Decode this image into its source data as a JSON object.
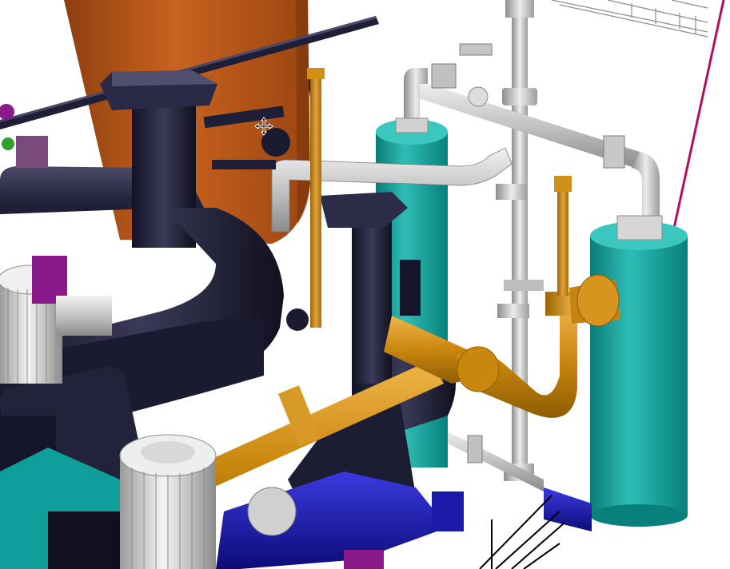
{
  "viewport": {
    "background": "#ffffff",
    "cursor": "move-cursor-icon"
  },
  "palette": {
    "navy_pipe": "#24243e",
    "navy_dark": "#121226",
    "navy_light": "#4a4a68",
    "orange_tank": "#b5561c",
    "orange_light": "#d7702c",
    "gold_pipe": "#c9870e",
    "gold_light": "#e4a63a",
    "teal_vessel": "#0f9e9a",
    "teal_light": "#3cc6c0",
    "gray_pipe": "#b8b8b8",
    "gray_light": "#e6e6e6",
    "blue_base": "#1a1aa8",
    "magenta": "#8a1a8a",
    "crimson_line": "#b0105a",
    "wire_gray": "#8c8c8c"
  },
  "scene": {
    "objects": [
      "orange-storage-tank",
      "navy-main-pipe",
      "navy-secondary-pipe",
      "gold-pipe-run",
      "teal-vessel-left",
      "teal-vessel-right",
      "gray-vertical-riser",
      "gray-cross-header",
      "gray-bend-pipe",
      "pump-motor-left",
      "pump-motor-bottom",
      "blue-base-frame",
      "cable-tray",
      "crimson-guide-line"
    ]
  }
}
